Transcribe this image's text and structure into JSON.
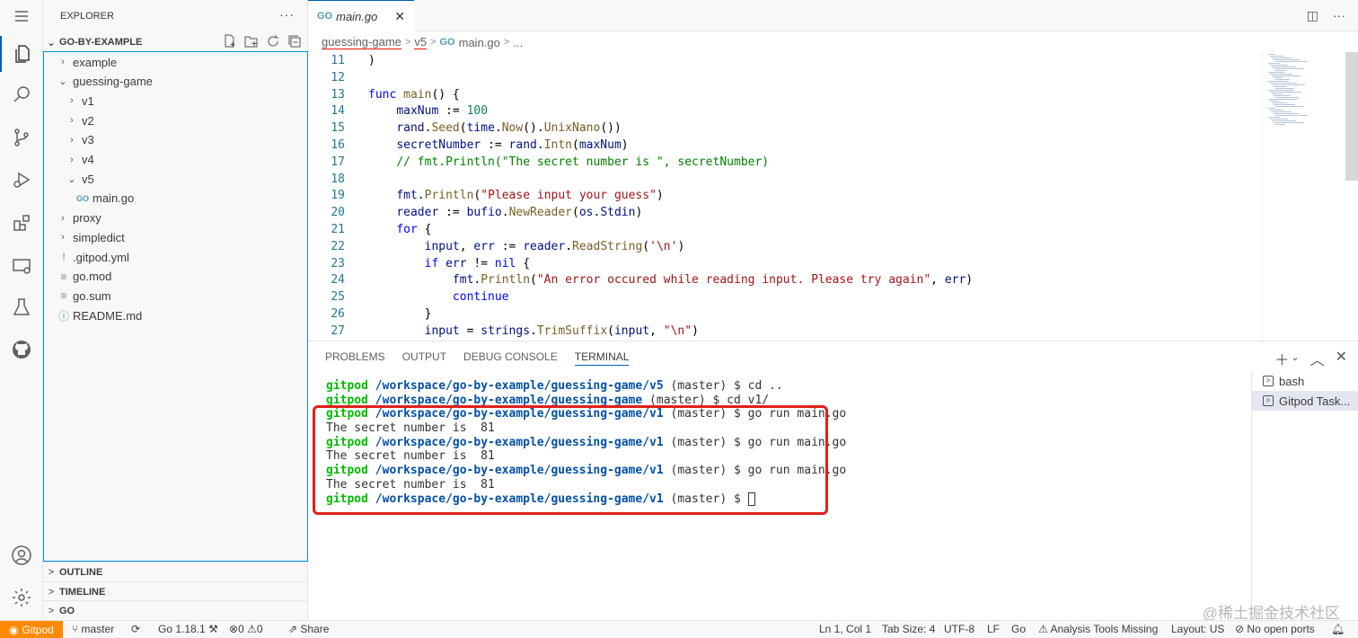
{
  "sidebar": {
    "title": "EXPLORER",
    "root": "GO-BY-EXAMPLE",
    "tree": [
      {
        "label": "example",
        "twisty": ">",
        "depth": 0
      },
      {
        "label": "guessing-game",
        "twisty": "v",
        "depth": 0
      },
      {
        "label": "v1",
        "twisty": ">",
        "depth": 1
      },
      {
        "label": "v2",
        "twisty": ">",
        "depth": 1
      },
      {
        "label": "v3",
        "twisty": ">",
        "depth": 1
      },
      {
        "label": "v4",
        "twisty": ">",
        "depth": 1
      },
      {
        "label": "v5",
        "twisty": "v",
        "depth": 1
      },
      {
        "label": "main.go",
        "twisty": "",
        "depth": 2,
        "icon": "go-file-icon"
      },
      {
        "label": "proxy",
        "twisty": ">",
        "depth": 0
      },
      {
        "label": "simpledict",
        "twisty": ">",
        "depth": 0
      },
      {
        "label": ".gitpod.yml",
        "twisty": "",
        "depth": 0,
        "icon": "yaml-file-icon"
      },
      {
        "label": "go.mod",
        "twisty": "",
        "depth": 0,
        "icon": "text-file-icon"
      },
      {
        "label": "go.sum",
        "twisty": "",
        "depth": 0,
        "icon": "text-file-icon"
      },
      {
        "label": "README.md",
        "twisty": "",
        "depth": 0,
        "icon": "info-file-icon"
      }
    ],
    "sections": [
      "OUTLINE",
      "TIMELINE",
      "GO"
    ]
  },
  "editor": {
    "tab": "main.go",
    "breadcrumb": [
      "guessing-game",
      "v5",
      "main.go",
      "..."
    ],
    "lines": [
      {
        "n": "11",
        "html": "<span class=\"pl\">)</span>"
      },
      {
        "n": "12",
        "html": ""
      },
      {
        "n": "13",
        "html": "<span class=\"kw\">func</span> <span class=\"fn\">main</span><span class=\"pl\">() {</span>"
      },
      {
        "n": "14",
        "html": "    <span class=\"id\">maxNum</span> <span class=\"pl\">:=</span> <span class=\"num\">100</span>"
      },
      {
        "n": "15",
        "html": "    <span class=\"id\">rand</span><span class=\"pl\">.</span><span class=\"fn\">Seed</span><span class=\"pl\">(</span><span class=\"id\">time</span><span class=\"pl\">.</span><span class=\"fn\">Now</span><span class=\"pl\">().</span><span class=\"fn\">UnixNano</span><span class=\"pl\">())</span>"
      },
      {
        "n": "16",
        "html": "    <span class=\"id\">secretNumber</span> <span class=\"pl\">:=</span> <span class=\"id\">rand</span><span class=\"pl\">.</span><span class=\"fn\">Intn</span><span class=\"pl\">(</span><span class=\"id\">maxNum</span><span class=\"pl\">)</span>"
      },
      {
        "n": "17",
        "html": "    <span class=\"cm\">// fmt.Println(\"The secret number is \", secretNumber)</span>"
      },
      {
        "n": "18",
        "html": ""
      },
      {
        "n": "19",
        "html": "    <span class=\"id\">fmt</span><span class=\"pl\">.</span><span class=\"fn\">Println</span><span class=\"pl\">(</span><span class=\"str\">\"Please input your guess\"</span><span class=\"pl\">)</span>"
      },
      {
        "n": "20",
        "html": "    <span class=\"id\">reader</span> <span class=\"pl\">:=</span> <span class=\"id\">bufio</span><span class=\"pl\">.</span><span class=\"fn\">NewReader</span><span class=\"pl\">(</span><span class=\"id\">os</span><span class=\"pl\">.</span><span class=\"id\">Stdin</span><span class=\"pl\">)</span>"
      },
      {
        "n": "21",
        "html": "    <span class=\"kw\">for</span> <span class=\"pl\">{</span>"
      },
      {
        "n": "22",
        "html": "        <span class=\"id\">input</span><span class=\"pl\">,</span> <span class=\"id\">err</span> <span class=\"pl\">:=</span> <span class=\"id\">reader</span><span class=\"pl\">.</span><span class=\"fn\">ReadString</span><span class=\"pl\">(</span><span class=\"str\">'\\n'</span><span class=\"pl\">)</span>"
      },
      {
        "n": "23",
        "html": "        <span class=\"kw\">if</span> <span class=\"id\">err</span> <span class=\"pl\">!=</span> <span class=\"kw\">nil</span> <span class=\"pl\">{</span>"
      },
      {
        "n": "24",
        "html": "            <span class=\"id\">fmt</span><span class=\"pl\">.</span><span class=\"fn\">Println</span><span class=\"pl\">(</span><span class=\"str\">\"An error occured while reading input. Please try again\"</span><span class=\"pl\">,</span> <span class=\"id\">err</span><span class=\"pl\">)</span>"
      },
      {
        "n": "25",
        "html": "            <span class=\"kw\">continue</span>"
      },
      {
        "n": "26",
        "html": "        <span class=\"pl\">}</span>"
      },
      {
        "n": "27",
        "html": "        <span class=\"id\">input</span> <span class=\"pl\">=</span> <span class=\"id\">strings</span><span class=\"pl\">.</span><span class=\"fn\">TrimSuffix</span><span class=\"pl\">(</span><span class=\"id\">input</span><span class=\"pl\">,</span> <span class=\"str\">\"\\n\"</span><span class=\"pl\">)</span>"
      }
    ]
  },
  "panel": {
    "tabs": [
      "PROBLEMS",
      "OUTPUT",
      "DEBUG CONSOLE",
      "TERMINAL"
    ],
    "active_tab": "TERMINAL",
    "terminal_lines": [
      {
        "user": "gitpod",
        "path": "/workspace/go-by-example/guessing-game/v5",
        "rest": " (master) $ cd .."
      },
      {
        "user": "gitpod",
        "path": "/workspace/go-by-example/guessing-game",
        "rest": " (master) $ cd v1/"
      },
      {
        "user": "gitpod",
        "path": "/workspace/go-by-example/guessing-game/v1",
        "rest": " (master) $ go run main.go"
      },
      {
        "text": "The secret number is  81"
      },
      {
        "user": "gitpod",
        "path": "/workspace/go-by-example/guessing-game/v1",
        "rest": " (master) $ go run main.go"
      },
      {
        "text": "The secret number is  81"
      },
      {
        "user": "gitpod",
        "path": "/workspace/go-by-example/guessing-game/v1",
        "rest": " (master) $ go run main.go"
      },
      {
        "text": "The secret number is  81"
      },
      {
        "user": "gitpod",
        "path": "/workspace/go-by-example/guessing-game/v1",
        "rest": " (master) $ ",
        "cursor": true
      }
    ],
    "terminals": [
      "bash",
      "Gitpod Task..."
    ]
  },
  "watermark": "@稀土掘金技术社区",
  "statusbar": {
    "remote": "Gitpod",
    "branch": "master",
    "go_version": "Go 1.18.1",
    "errors": "0",
    "warnings": "0",
    "share": "Share",
    "position": "Ln 1, Col 1",
    "tab_size": "Tab Size: 4",
    "encoding": "UTF-8",
    "eol": "LF",
    "language": "Go",
    "analysis": "Analysis Tools Missing",
    "layout": "Layout: US",
    "ports": "No open ports"
  }
}
